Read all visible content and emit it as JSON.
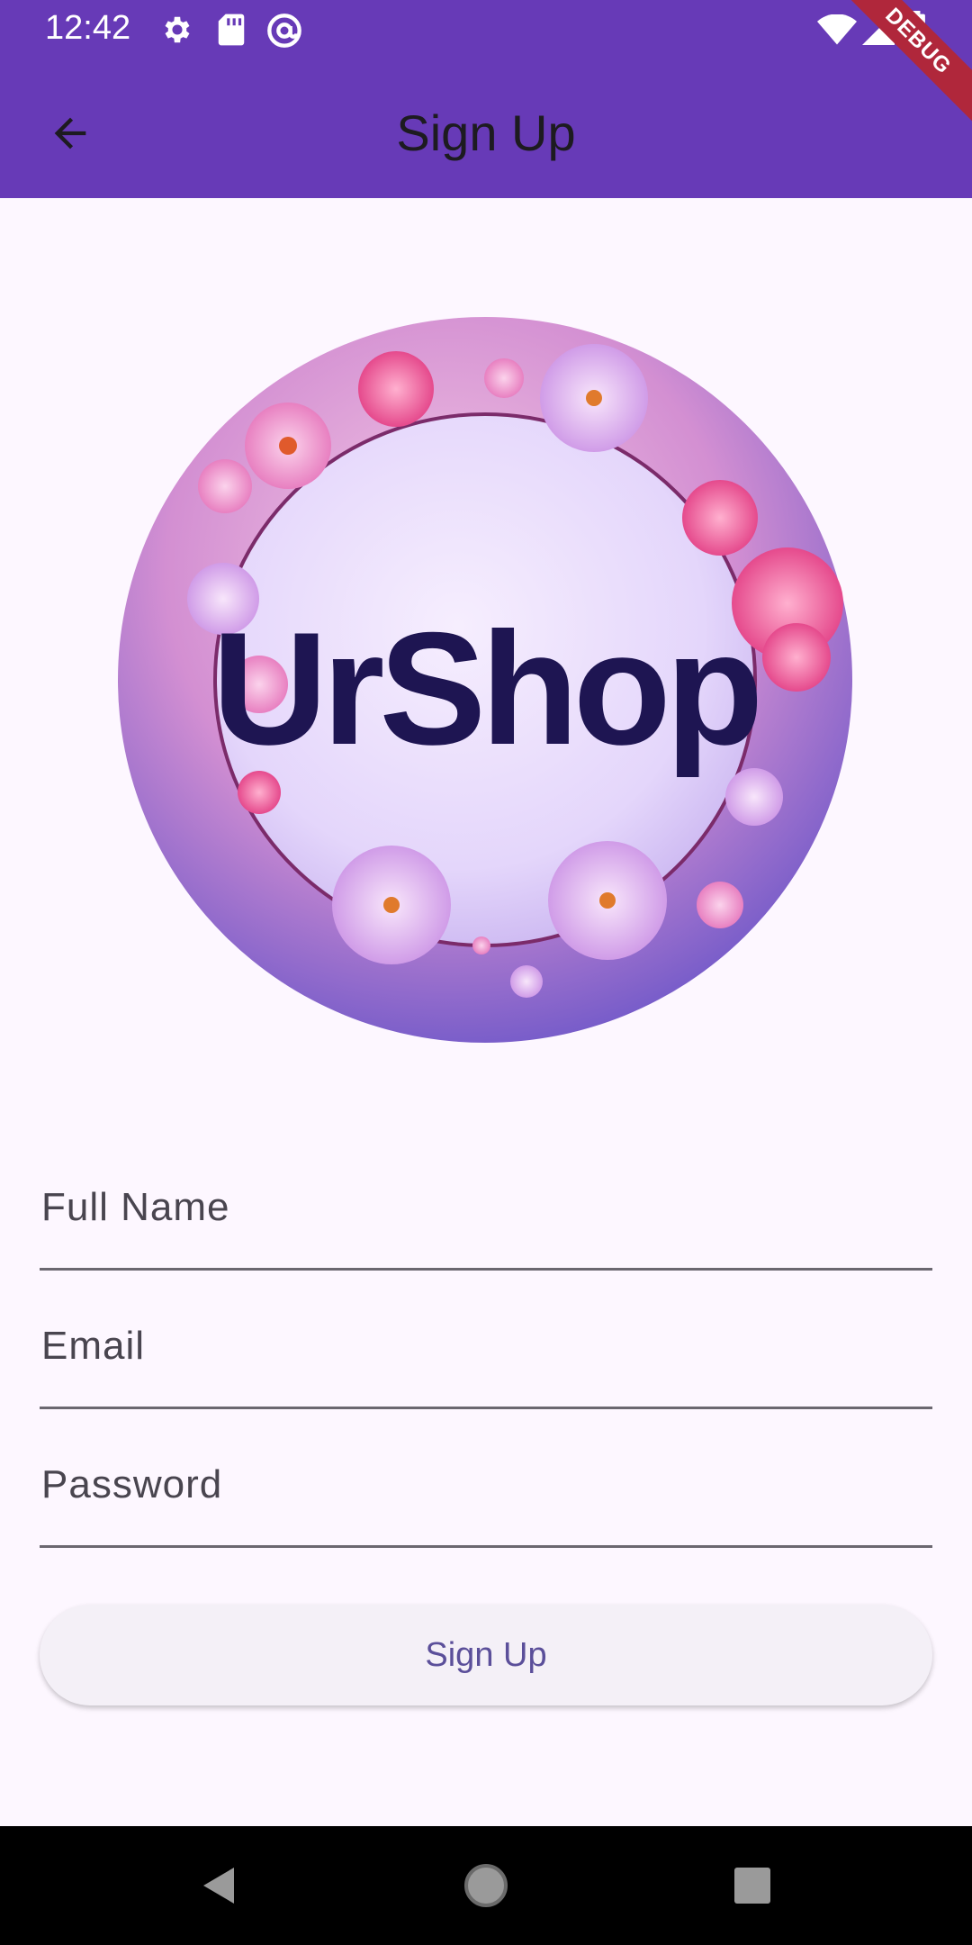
{
  "status_bar": {
    "time": "12:42",
    "left_icons": [
      "settings-icon",
      "sd-card-icon",
      "at-sign-icon"
    ],
    "right_icons": [
      "wifi-icon",
      "cell-signal-icon",
      "battery-icon"
    ]
  },
  "debug_banner": "DEBUG",
  "app_bar": {
    "title": "Sign Up",
    "back_icon": "arrow-back-icon",
    "background": "#673ab7"
  },
  "logo": {
    "text": "UrShop"
  },
  "form": {
    "full_name": {
      "label": "Full Name",
      "value": ""
    },
    "email": {
      "label": "Email",
      "value": ""
    },
    "password": {
      "label": "Password",
      "value": ""
    },
    "submit_label": "Sign Up"
  },
  "nav_bar": {
    "icons": [
      "back-triangle-icon",
      "home-circle-icon",
      "recents-square-icon"
    ]
  }
}
